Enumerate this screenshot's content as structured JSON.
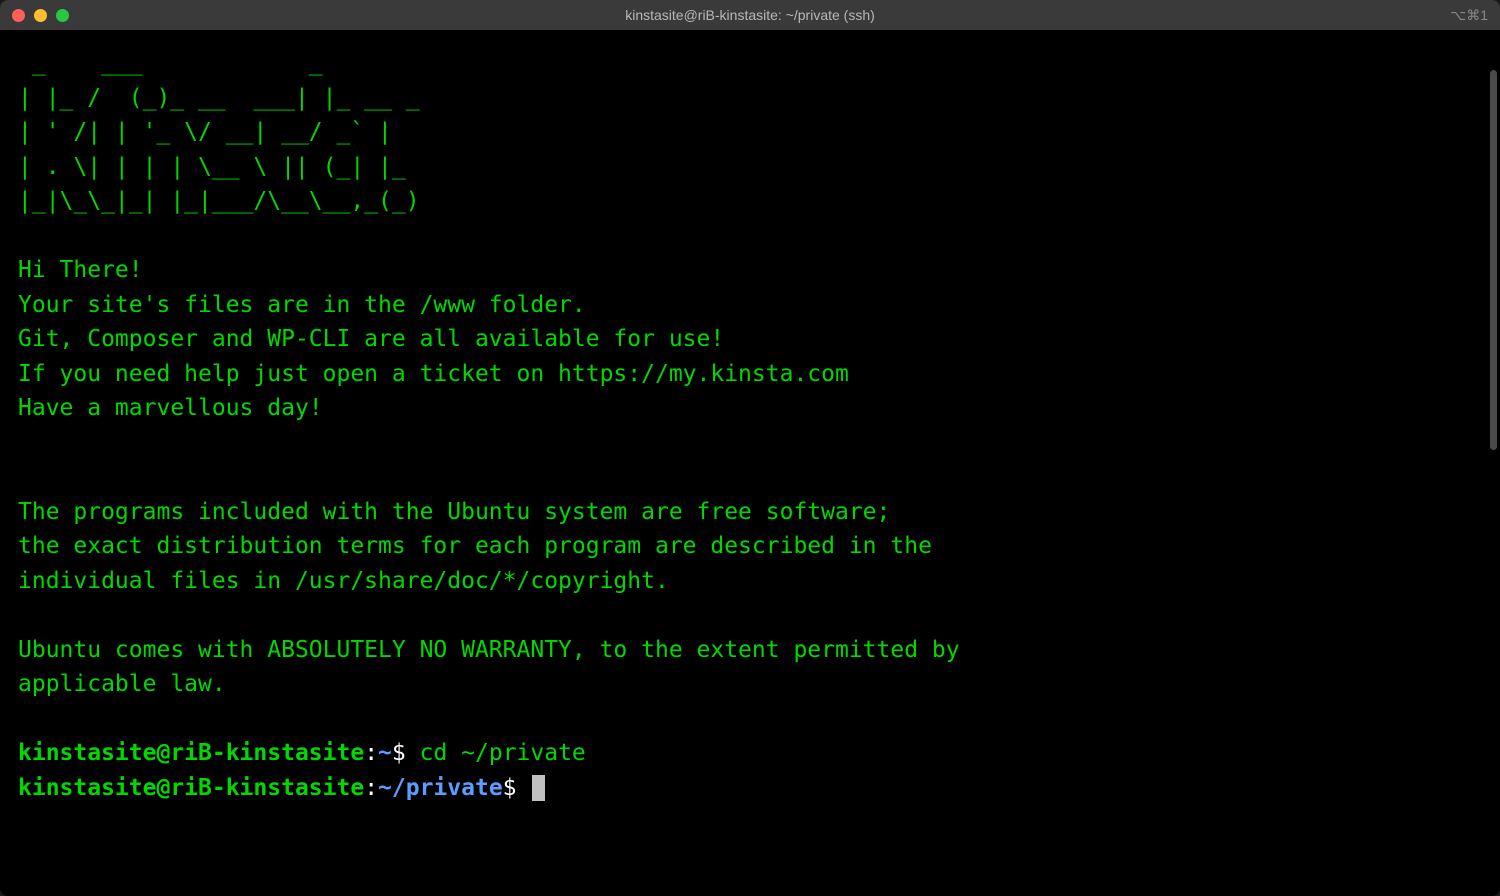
{
  "window": {
    "title": "kinstasite@riB-kinstasite: ~/private (ssh)",
    "shortcut": "⌥⌘1"
  },
  "ascii_art": " _    ___            _\n| |_ /  (_)_ __  ___| |_ __ _\n| ' /| | '_ \\/ __| __/ _` |\n| . \\| | | | \\__ \\ || (_| |_\n|_|\\_\\_|_| |_|___/\\__\\__,_(_)",
  "motd": {
    "greeting": "Hi There!",
    "line1": "Your site's files are in the /www folder.",
    "line2": "Git, Composer and WP-CLI are all available for use!",
    "line3": "If you need help just open a ticket on https://my.kinsta.com",
    "line4": "Have a marvellous day!",
    "ubuntu1": "The programs included with the Ubuntu system are free software;",
    "ubuntu2": "the exact distribution terms for each program are described in the",
    "ubuntu3": "individual files in /usr/share/doc/*/copyright.",
    "ubuntu4": "Ubuntu comes with ABSOLUTELY NO WARRANTY, to the extent permitted by",
    "ubuntu5": "applicable law."
  },
  "prompts": {
    "p1_user": "kinstasite@riB-kinstasite",
    "p1_sep": ":",
    "p1_path": "~",
    "p1_dollar": "$ ",
    "p1_cmd": "cd ~/private",
    "p2_user": "kinstasite@riB-kinstasite",
    "p2_sep": ":",
    "p2_path": "~/private",
    "p2_dollar": "$ "
  }
}
